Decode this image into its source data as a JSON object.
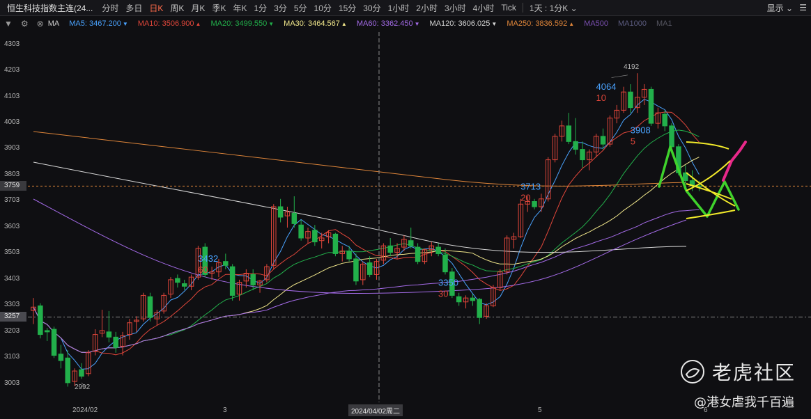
{
  "header": {
    "title": "恒生科技指数主连(24...",
    "timeframes": [
      {
        "label": "分时",
        "active": false
      },
      {
        "label": "多日",
        "active": false
      },
      {
        "label": "日K",
        "active": true
      },
      {
        "label": "周K",
        "active": false
      },
      {
        "label": "月K",
        "active": false
      },
      {
        "label": "季K",
        "active": false
      },
      {
        "label": "年K",
        "active": false
      },
      {
        "label": "1分",
        "active": false
      },
      {
        "label": "3分",
        "active": false
      },
      {
        "label": "5分",
        "active": false
      },
      {
        "label": "10分",
        "active": false
      },
      {
        "label": "15分",
        "active": false
      },
      {
        "label": "30分",
        "active": false
      },
      {
        "label": "1小时",
        "active": false
      },
      {
        "label": "2小时",
        "active": false
      },
      {
        "label": "3小时",
        "active": false
      },
      {
        "label": "4小时",
        "active": false
      },
      {
        "label": "Tick",
        "active": false
      }
    ],
    "range_selector": "1天 : 1分K ⌄",
    "display_label": "显示 ⌄",
    "menu_icon": "hamburger-icon"
  },
  "ma_bar": {
    "label": "MA",
    "items": [
      {
        "name": "MA5",
        "value": "3467.200",
        "arrow": "▼",
        "color": "#4aa3ff"
      },
      {
        "name": "MA10",
        "value": "3506.900",
        "arrow": "▲",
        "color": "#e0463a"
      },
      {
        "name": "MA20",
        "value": "3499.550",
        "arrow": "▼",
        "color": "#22b04b"
      },
      {
        "name": "MA30",
        "value": "3464.567",
        "arrow": "▲",
        "color": "#f2e88c"
      },
      {
        "name": "MA60",
        "value": "3362.450",
        "arrow": "▼",
        "color": "#a46be8"
      },
      {
        "name": "MA120",
        "value": "3606.025",
        "arrow": "▼",
        "color": "#d8d8d8"
      },
      {
        "name": "MA250",
        "value": "3836.592",
        "arrow": "▲",
        "color": "#e0863a"
      },
      {
        "name": "MA500",
        "value": "",
        "arrow": "",
        "color": "#7a4fb0"
      },
      {
        "name": "MA1000",
        "value": "",
        "arrow": "",
        "color": "#5c5c80"
      },
      {
        "name": "MA1",
        "value": "",
        "arrow": "",
        "color": "#555560"
      }
    ]
  },
  "y_axis": {
    "labels": [
      "4303",
      "4203",
      "4103",
      "4003",
      "3903",
      "3803",
      "3703",
      "3603",
      "3503",
      "3403",
      "3303",
      "3203",
      "3103",
      "3003"
    ],
    "current_tag": "3759",
    "hover_tag": "3257"
  },
  "x_axis": {
    "labels": [
      {
        "text": "2024/02"
      },
      {
        "text": "3"
      },
      {
        "text": "5"
      },
      {
        "text": "6"
      }
    ],
    "hover_label": "2024/04/02周二"
  },
  "chart_data": {
    "type": "candlestick",
    "ylim": [
      2930,
      4350
    ],
    "candles": [
      {
        "o": 3282,
        "h": 3330,
        "l": 3230,
        "c": 3295
      },
      {
        "o": 3300,
        "h": 3310,
        "l": 3175,
        "c": 3190
      },
      {
        "o": 3205,
        "h": 3215,
        "l": 3165,
        "c": 3200
      },
      {
        "o": 3210,
        "h": 3220,
        "l": 3100,
        "c": 3110
      },
      {
        "o": 3115,
        "h": 3150,
        "l": 3060,
        "c": 3090
      },
      {
        "o": 3100,
        "h": 3130,
        "l": 2990,
        "c": 3005
      },
      {
        "o": 3010,
        "h": 3060,
        "l": 2992,
        "c": 3050
      },
      {
        "o": 3055,
        "h": 3080,
        "l": 3020,
        "c": 3030
      },
      {
        "o": 3040,
        "h": 3130,
        "l": 3030,
        "c": 3120
      },
      {
        "o": 3125,
        "h": 3210,
        "l": 3110,
        "c": 3190
      },
      {
        "o": 3195,
        "h": 3285,
        "l": 3180,
        "c": 3205
      },
      {
        "o": 3200,
        "h": 3280,
        "l": 3160,
        "c": 3180
      },
      {
        "o": 3180,
        "h": 3200,
        "l": 3120,
        "c": 3140
      },
      {
        "o": 3145,
        "h": 3200,
        "l": 3110,
        "c": 3185
      },
      {
        "o": 3190,
        "h": 3250,
        "l": 3170,
        "c": 3235
      },
      {
        "o": 3240,
        "h": 3260,
        "l": 3200,
        "c": 3245
      },
      {
        "o": 3250,
        "h": 3350,
        "l": 3240,
        "c": 3340
      },
      {
        "o": 3335,
        "h": 3350,
        "l": 3240,
        "c": 3255
      },
      {
        "o": 3250,
        "h": 3285,
        "l": 3225,
        "c": 3275
      },
      {
        "o": 3280,
        "h": 3350,
        "l": 3270,
        "c": 3340
      },
      {
        "o": 3345,
        "h": 3410,
        "l": 3330,
        "c": 3400
      },
      {
        "o": 3405,
        "h": 3420,
        "l": 3370,
        "c": 3390
      },
      {
        "o": 3385,
        "h": 3400,
        "l": 3360,
        "c": 3375
      },
      {
        "o": 3375,
        "h": 3420,
        "l": 3360,
        "c": 3410
      },
      {
        "o": 3410,
        "h": 3530,
        "l": 3400,
        "c": 3520
      },
      {
        "o": 3525,
        "h": 3540,
        "l": 3410,
        "c": 3420
      },
      {
        "o": 3425,
        "h": 3450,
        "l": 3400,
        "c": 3430
      },
      {
        "o": 3430,
        "h": 3480,
        "l": 3410,
        "c": 3465
      },
      {
        "o": 3470,
        "h": 3500,
        "l": 3440,
        "c": 3455
      },
      {
        "o": 3450,
        "h": 3460,
        "l": 3320,
        "c": 3340
      },
      {
        "o": 3345,
        "h": 3400,
        "l": 3320,
        "c": 3390
      },
      {
        "o": 3395,
        "h": 3440,
        "l": 3370,
        "c": 3425
      },
      {
        "o": 3420,
        "h": 3440,
        "l": 3360,
        "c": 3380
      },
      {
        "o": 3380,
        "h": 3400,
        "l": 3350,
        "c": 3395
      },
      {
        "o": 3400,
        "h": 3460,
        "l": 3390,
        "c": 3450
      },
      {
        "o": 3455,
        "h": 3690,
        "l": 3440,
        "c": 3680
      },
      {
        "o": 3680,
        "h": 3710,
        "l": 3620,
        "c": 3640
      },
      {
        "o": 3645,
        "h": 3680,
        "l": 3600,
        "c": 3660
      },
      {
        "o": 3655,
        "h": 3720,
        "l": 3600,
        "c": 3615
      },
      {
        "o": 3610,
        "h": 3630,
        "l": 3550,
        "c": 3560
      },
      {
        "o": 3560,
        "h": 3600,
        "l": 3540,
        "c": 3585
      },
      {
        "o": 3590,
        "h": 3610,
        "l": 3530,
        "c": 3545
      },
      {
        "o": 3550,
        "h": 3580,
        "l": 3520,
        "c": 3560
      },
      {
        "o": 3565,
        "h": 3590,
        "l": 3540,
        "c": 3580
      },
      {
        "o": 3575,
        "h": 3580,
        "l": 3490,
        "c": 3500
      },
      {
        "o": 3500,
        "h": 3530,
        "l": 3470,
        "c": 3510
      },
      {
        "o": 3510,
        "h": 3530,
        "l": 3470,
        "c": 3480
      },
      {
        "o": 3480,
        "h": 3500,
        "l": 3380,
        "c": 3395
      },
      {
        "o": 3400,
        "h": 3470,
        "l": 3380,
        "c": 3460
      },
      {
        "o": 3465,
        "h": 3490,
        "l": 3410,
        "c": 3420
      },
      {
        "o": 3420,
        "h": 3480,
        "l": 3400,
        "c": 3470
      },
      {
        "o": 3475,
        "h": 3540,
        "l": 3460,
        "c": 3530
      },
      {
        "o": 3530,
        "h": 3560,
        "l": 3490,
        "c": 3505
      },
      {
        "o": 3505,
        "h": 3540,
        "l": 3480,
        "c": 3520
      },
      {
        "o": 3525,
        "h": 3570,
        "l": 3510,
        "c": 3555
      },
      {
        "o": 3550,
        "h": 3600,
        "l": 3520,
        "c": 3530
      },
      {
        "o": 3525,
        "h": 3540,
        "l": 3460,
        "c": 3470
      },
      {
        "o": 3470,
        "h": 3520,
        "l": 3460,
        "c": 3515
      },
      {
        "o": 3515,
        "h": 3545,
        "l": 3490,
        "c": 3530
      },
      {
        "o": 3525,
        "h": 3540,
        "l": 3490,
        "c": 3500
      },
      {
        "o": 3495,
        "h": 3520,
        "l": 3420,
        "c": 3430
      },
      {
        "o": 3430,
        "h": 3445,
        "l": 3330,
        "c": 3340
      },
      {
        "o": 3335,
        "h": 3350,
        "l": 3300,
        "c": 3315
      },
      {
        "o": 3315,
        "h": 3340,
        "l": 3290,
        "c": 3330
      },
      {
        "o": 3330,
        "h": 3345,
        "l": 3300,
        "c": 3320
      },
      {
        "o": 3325,
        "h": 3330,
        "l": 3230,
        "c": 3255
      },
      {
        "o": 3260,
        "h": 3310,
        "l": 3250,
        "c": 3300
      },
      {
        "o": 3300,
        "h": 3380,
        "l": 3295,
        "c": 3370
      },
      {
        "o": 3370,
        "h": 3440,
        "l": 3360,
        "c": 3430
      },
      {
        "o": 3430,
        "h": 3570,
        "l": 3420,
        "c": 3560
      },
      {
        "o": 3555,
        "h": 3580,
        "l": 3520,
        "c": 3565
      },
      {
        "o": 3565,
        "h": 3710,
        "l": 3560,
        "c": 3690
      },
      {
        "o": 3690,
        "h": 3720,
        "l": 3660,
        "c": 3700
      },
      {
        "o": 3700,
        "h": 3710,
        "l": 3670,
        "c": 3680
      },
      {
        "o": 3680,
        "h": 3730,
        "l": 3660,
        "c": 3710
      },
      {
        "o": 3710,
        "h": 3870,
        "l": 3700,
        "c": 3860
      },
      {
        "o": 3860,
        "h": 3960,
        "l": 3850,
        "c": 3950
      },
      {
        "o": 3950,
        "h": 4010,
        "l": 3930,
        "c": 3990
      },
      {
        "o": 3990,
        "h": 4040,
        "l": 3920,
        "c": 3930
      },
      {
        "o": 3930,
        "h": 4020,
        "l": 3880,
        "c": 3900
      },
      {
        "o": 3900,
        "h": 3930,
        "l": 3830,
        "c": 3860
      },
      {
        "o": 3860,
        "h": 3900,
        "l": 3820,
        "c": 3890
      },
      {
        "o": 3890,
        "h": 3960,
        "l": 3870,
        "c": 3950
      },
      {
        "o": 3950,
        "h": 3980,
        "l": 3900,
        "c": 3920
      },
      {
        "o": 3920,
        "h": 4030,
        "l": 3910,
        "c": 4020
      },
      {
        "o": 4020,
        "h": 4070,
        "l": 4000,
        "c": 4050
      },
      {
        "o": 4050,
        "h": 4140,
        "l": 4040,
        "c": 4120
      },
      {
        "o": 4120,
        "h": 4150,
        "l": 4040,
        "c": 4060
      },
      {
        "o": 4060,
        "h": 4192,
        "l": 4040,
        "c": 4100
      },
      {
        "o": 4100,
        "h": 4150,
        "l": 4070,
        "c": 4130
      },
      {
        "o": 4130,
        "h": 4140,
        "l": 3990,
        "c": 4000
      },
      {
        "o": 4000,
        "h": 4060,
        "l": 3980,
        "c": 4040
      },
      {
        "o": 4035,
        "h": 4050,
        "l": 3970,
        "c": 3990
      },
      {
        "o": 3990,
        "h": 4000,
        "l": 3900,
        "c": 3910
      },
      {
        "o": 3910,
        "h": 3920,
        "l": 3800,
        "c": 3810
      },
      {
        "o": 3810,
        "h": 3840,
        "l": 3760,
        "c": 3780
      },
      {
        "o": 3780,
        "h": 3820,
        "l": 3740,
        "c": 3760
      },
      {
        "o": 3760,
        "h": 3780,
        "l": 3740,
        "c": 3759
      }
    ],
    "annotations": [
      {
        "text": "4064",
        "color": "#4aa3ff"
      },
      {
        "text": "10",
        "color": "#e0463a"
      },
      {
        "text": "4192",
        "color": "#b5b5b5"
      },
      {
        "text": "3908",
        "color": "#4aa3ff"
      },
      {
        "text": "5",
        "color": "#e0463a"
      },
      {
        "text": "3713",
        "color": "#4aa3ff"
      },
      {
        "text": "20",
        "color": "#e0463a"
      },
      {
        "text": "3432",
        "color": "#4aa3ff"
      },
      {
        "text": "60",
        "color": "#e0463a"
      },
      {
        "text": "3350",
        "color": "#4aa3ff"
      },
      {
        "text": "30",
        "color": "#e0463a"
      },
      {
        "text": "2992",
        "color": "#b5b5b5"
      }
    ],
    "current_price": 3759,
    "hover_price": 3257,
    "grid": false
  },
  "watermark": {
    "brand": "老虎社区",
    "author": "@港女虐我千百遍"
  }
}
